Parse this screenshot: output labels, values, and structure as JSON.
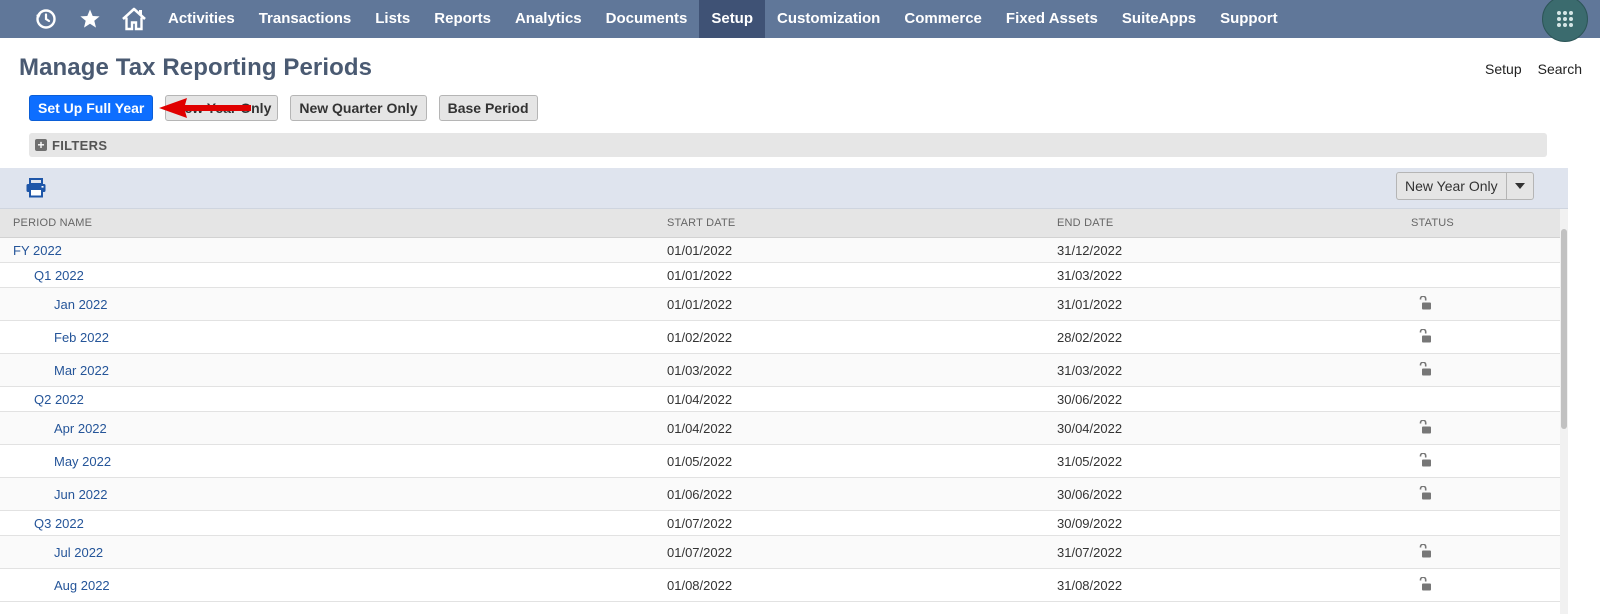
{
  "nav": {
    "icons": [
      "recent-records-icon",
      "star-icon",
      "home-icon"
    ],
    "items": [
      {
        "label": "Activities"
      },
      {
        "label": "Transactions"
      },
      {
        "label": "Lists"
      },
      {
        "label": "Reports"
      },
      {
        "label": "Analytics"
      },
      {
        "label": "Documents"
      },
      {
        "label": "Setup",
        "active": true
      },
      {
        "label": "Customization"
      },
      {
        "label": "Commerce"
      },
      {
        "label": "Fixed Assets"
      },
      {
        "label": "SuiteApps"
      },
      {
        "label": "Support"
      }
    ],
    "colors": {
      "bar": "#607799",
      "active": "#3f5275"
    }
  },
  "page": {
    "title": "Manage Tax Reporting Periods",
    "links": {
      "setup": "Setup",
      "search": "Search"
    }
  },
  "buttons": {
    "setup_full_year": "Set Up Full Year",
    "new_year_only": "New Year Only",
    "new_quarter_only": "New Quarter Only",
    "base_period": "Base Period",
    "primary_color": "#0d6eff"
  },
  "annotation": {
    "arrow_color": "#e00000"
  },
  "filters": {
    "label": "FILTERS"
  },
  "list_toolbar": {
    "split_button_label": "New Year Only"
  },
  "table": {
    "columns": {
      "name": "PERIOD NAME",
      "start": "START DATE",
      "end": "END DATE",
      "status": "STATUS"
    },
    "rows": [
      {
        "name": "FY 2022",
        "start": "01/01/2022",
        "end": "31/12/2022",
        "level": 0,
        "status_icon": ""
      },
      {
        "name": "Q1 2022",
        "start": "01/01/2022",
        "end": "31/03/2022",
        "level": 1,
        "status_icon": ""
      },
      {
        "name": "Jan 2022",
        "start": "01/01/2022",
        "end": "31/01/2022",
        "level": 2,
        "status_icon": "unlocked-icon"
      },
      {
        "name": "Feb 2022",
        "start": "01/02/2022",
        "end": "28/02/2022",
        "level": 2,
        "status_icon": "unlocked-icon"
      },
      {
        "name": "Mar 2022",
        "start": "01/03/2022",
        "end": "31/03/2022",
        "level": 2,
        "status_icon": "unlocked-icon"
      },
      {
        "name": "Q2 2022",
        "start": "01/04/2022",
        "end": "30/06/2022",
        "level": 1,
        "status_icon": ""
      },
      {
        "name": "Apr 2022",
        "start": "01/04/2022",
        "end": "30/04/2022",
        "level": 2,
        "status_icon": "unlocked-icon"
      },
      {
        "name": "May 2022",
        "start": "01/05/2022",
        "end": "31/05/2022",
        "level": 2,
        "status_icon": "unlocked-icon"
      },
      {
        "name": "Jun 2022",
        "start": "01/06/2022",
        "end": "30/06/2022",
        "level": 2,
        "status_icon": "unlocked-icon"
      },
      {
        "name": "Q3 2022",
        "start": "01/07/2022",
        "end": "30/09/2022",
        "level": 1,
        "status_icon": ""
      },
      {
        "name": "Jul 2022",
        "start": "01/07/2022",
        "end": "31/07/2022",
        "level": 2,
        "status_icon": "unlocked-icon"
      },
      {
        "name": "Aug 2022",
        "start": "01/08/2022",
        "end": "31/08/2022",
        "level": 2,
        "status_icon": "unlocked-icon"
      }
    ]
  }
}
